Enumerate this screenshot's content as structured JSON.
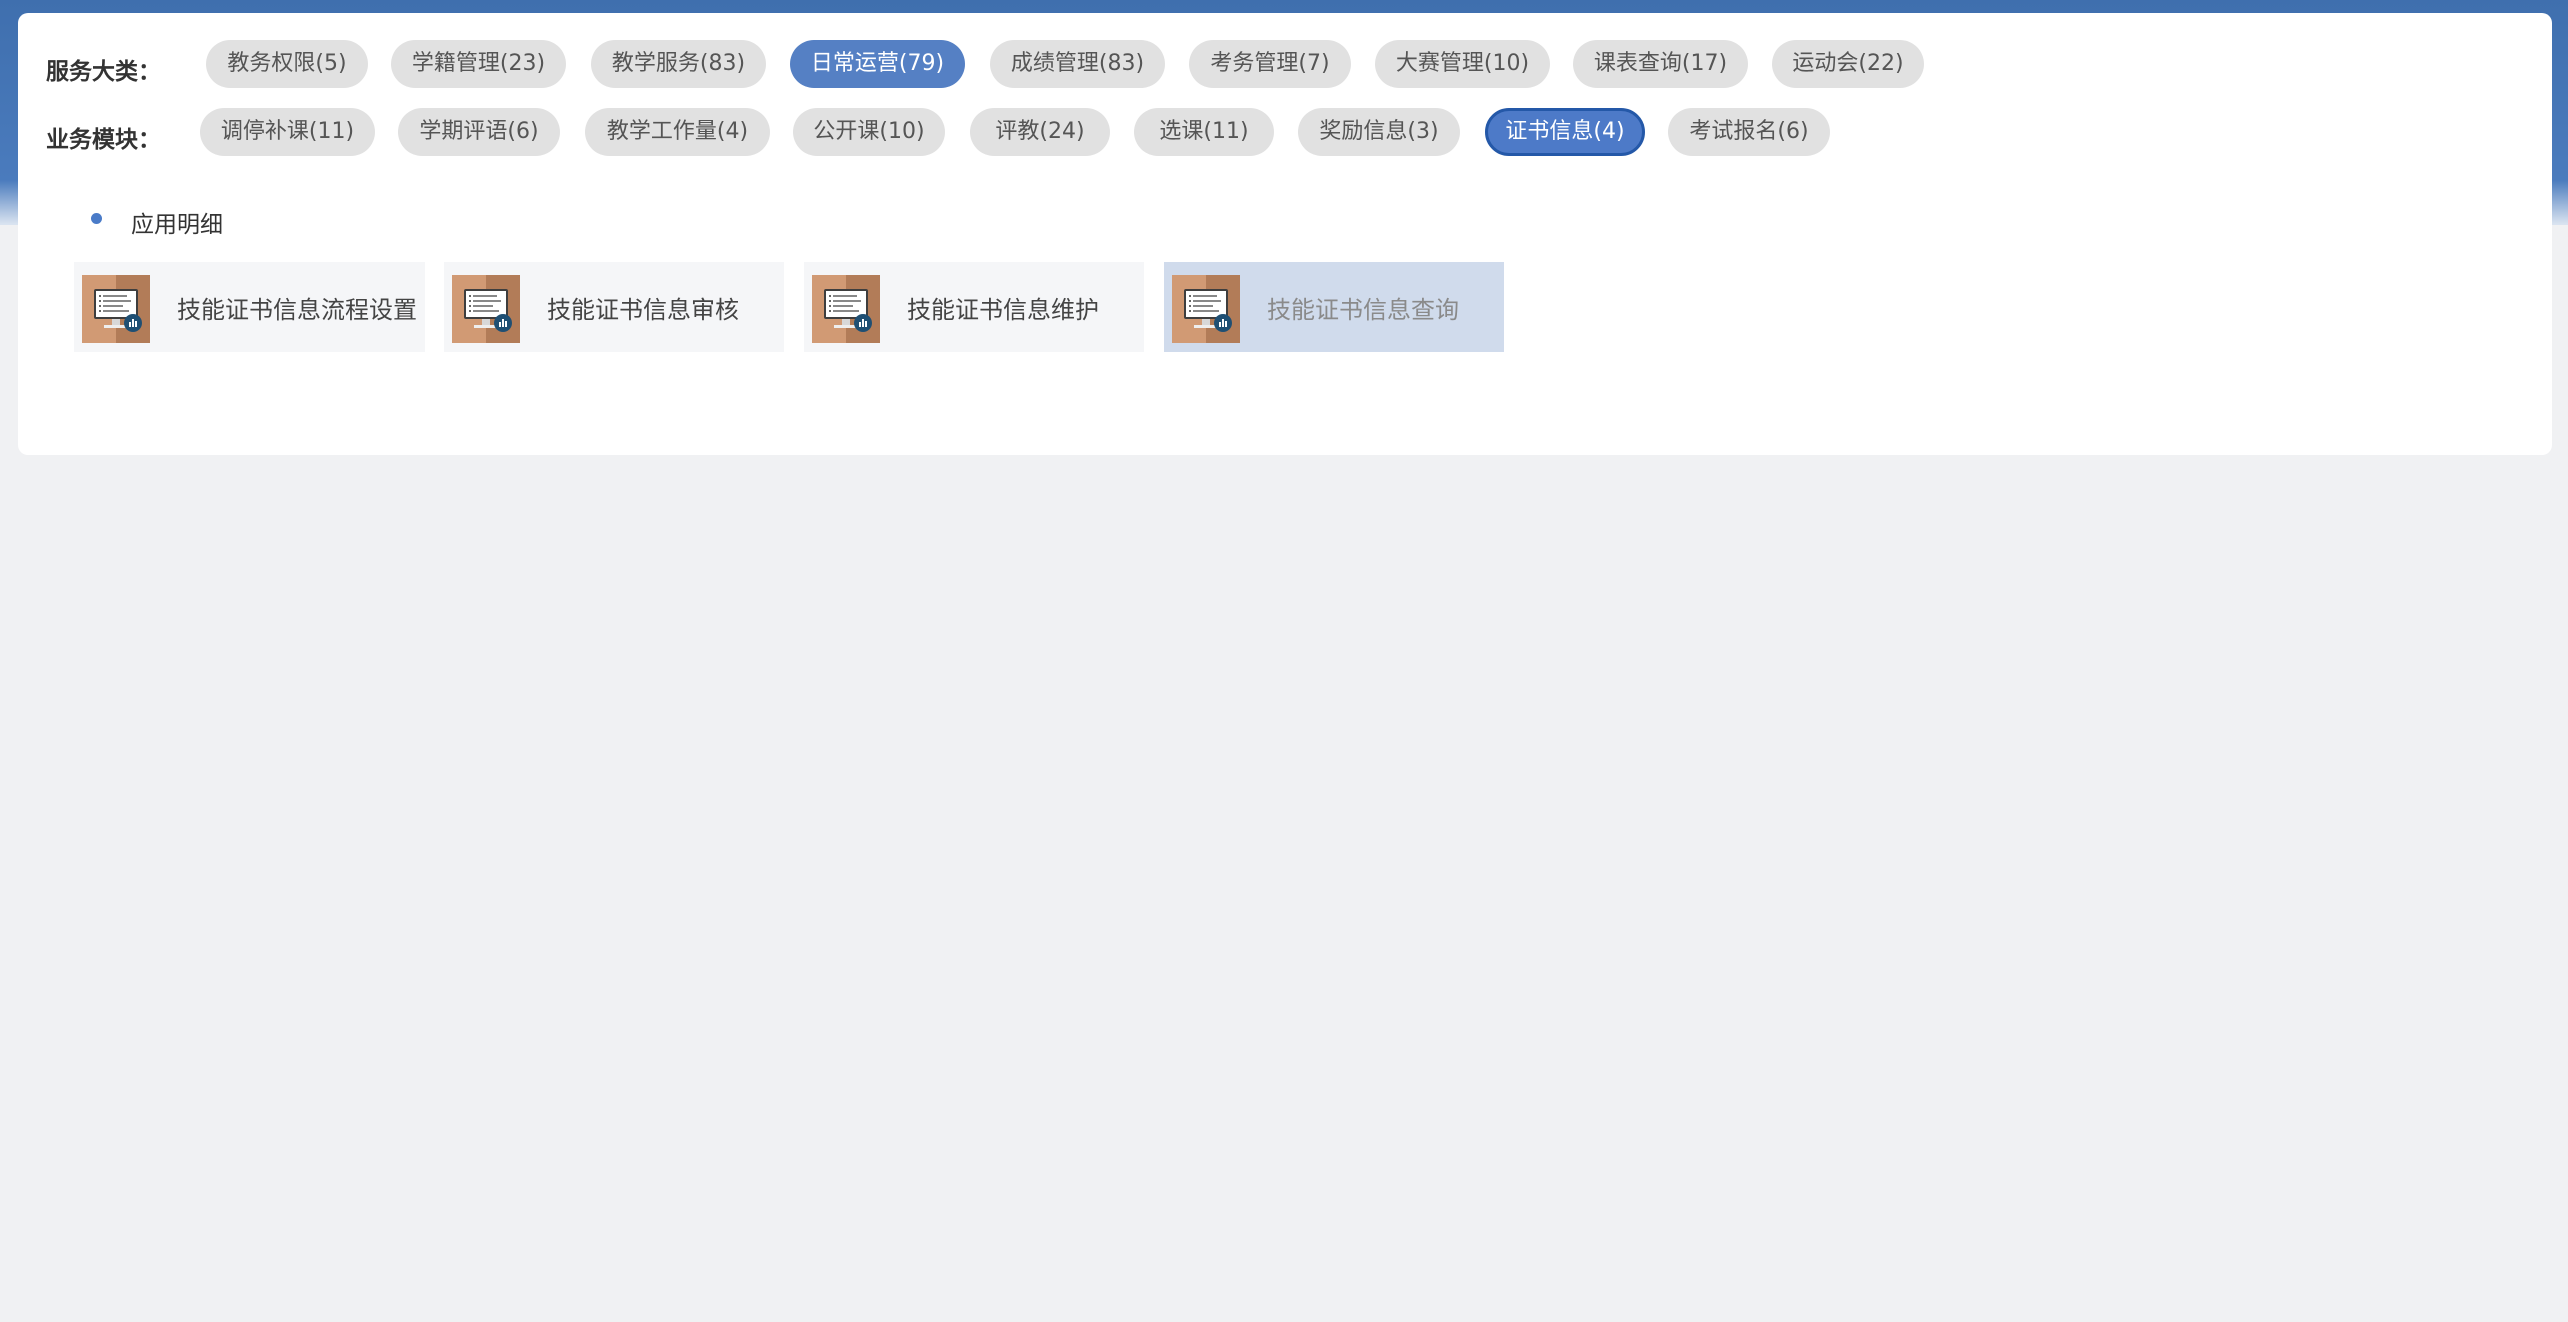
{
  "colors": {
    "accent": "#5580c4",
    "accent_selected": "#4d7ac8",
    "pill_bg": "#e1e1e1",
    "card_bg": "#f5f6f8",
    "card_selected_bg": "#d0dbec",
    "header_blue": "#4a7bbd",
    "page_bg": "#f0f1f3"
  },
  "service_categories": {
    "label": "服务大类：",
    "items": [
      {
        "label": "教务权限(5)",
        "active": false
      },
      {
        "label": "学籍管理(23)",
        "active": false
      },
      {
        "label": "教学服务(83)",
        "active": false
      },
      {
        "label": "日常运营(79)",
        "active": true
      },
      {
        "label": "成绩管理(83)",
        "active": false
      },
      {
        "label": "考务管理(7)",
        "active": false
      },
      {
        "label": "大赛管理(10)",
        "active": false
      },
      {
        "label": "课表查询(17)",
        "active": false
      },
      {
        "label": "运动会(22)",
        "active": false
      }
    ]
  },
  "business_modules": {
    "label": "业务模块：",
    "items": [
      {
        "label": "调停补课(11)",
        "active": false
      },
      {
        "label": "学期评语(6)",
        "active": false
      },
      {
        "label": "教学工作量(4)",
        "active": false
      },
      {
        "label": "公开课(10)",
        "active": false
      },
      {
        "label": "评教(24)",
        "active": false
      },
      {
        "label": "选课(11)",
        "active": false
      },
      {
        "label": "奖励信息(3)",
        "active": false
      },
      {
        "label": "证书信息(4)",
        "active": true
      },
      {
        "label": "考试报名(6)",
        "active": false
      }
    ]
  },
  "app_details": {
    "title": "应用明细",
    "apps": [
      {
        "label": "技能证书信息流程设置",
        "icon": "computer-app-icon",
        "selected": false
      },
      {
        "label": "技能证书信息审核",
        "icon": "computer-app-icon",
        "selected": false
      },
      {
        "label": "技能证书信息维护",
        "icon": "computer-app-icon",
        "selected": false
      },
      {
        "label": "技能证书信息查询",
        "icon": "computer-app-icon",
        "selected": true
      }
    ]
  }
}
